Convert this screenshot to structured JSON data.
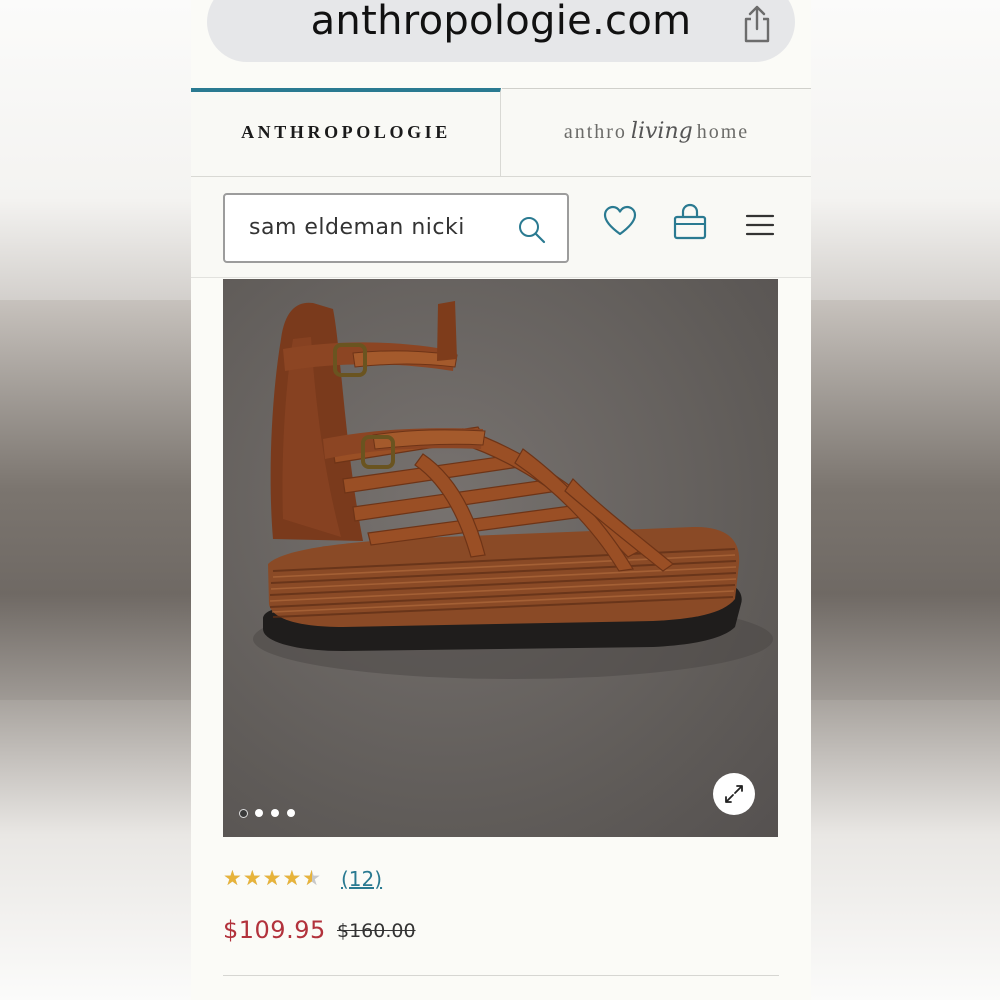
{
  "browser": {
    "url": "anthropologie.com",
    "share_icon": "share-icon"
  },
  "header": {
    "tabs": [
      {
        "label": "ANTHROPOLOGIE",
        "active": true
      },
      {
        "label_before": "anthro",
        "label_script": "living",
        "label_after": "home",
        "active": false
      }
    ],
    "accent_color": "#2a7a91"
  },
  "search": {
    "value": "sam eldeman nicki",
    "icon": "search-icon"
  },
  "nav_icons": [
    "heart-icon",
    "bag-icon",
    "menu-icon"
  ],
  "product": {
    "image_alt": "Brown leather woven platform gladiator sandal",
    "carousel": {
      "count": 4,
      "active_index": 0
    },
    "expand_icon": "expand-icon",
    "rating": {
      "stars": 4.5,
      "max": 5,
      "review_count": "(12)",
      "star_color": "#e7b33a"
    },
    "sale_price": "$109.95",
    "original_price": "$160.00",
    "sale_color": "#b2323c"
  }
}
